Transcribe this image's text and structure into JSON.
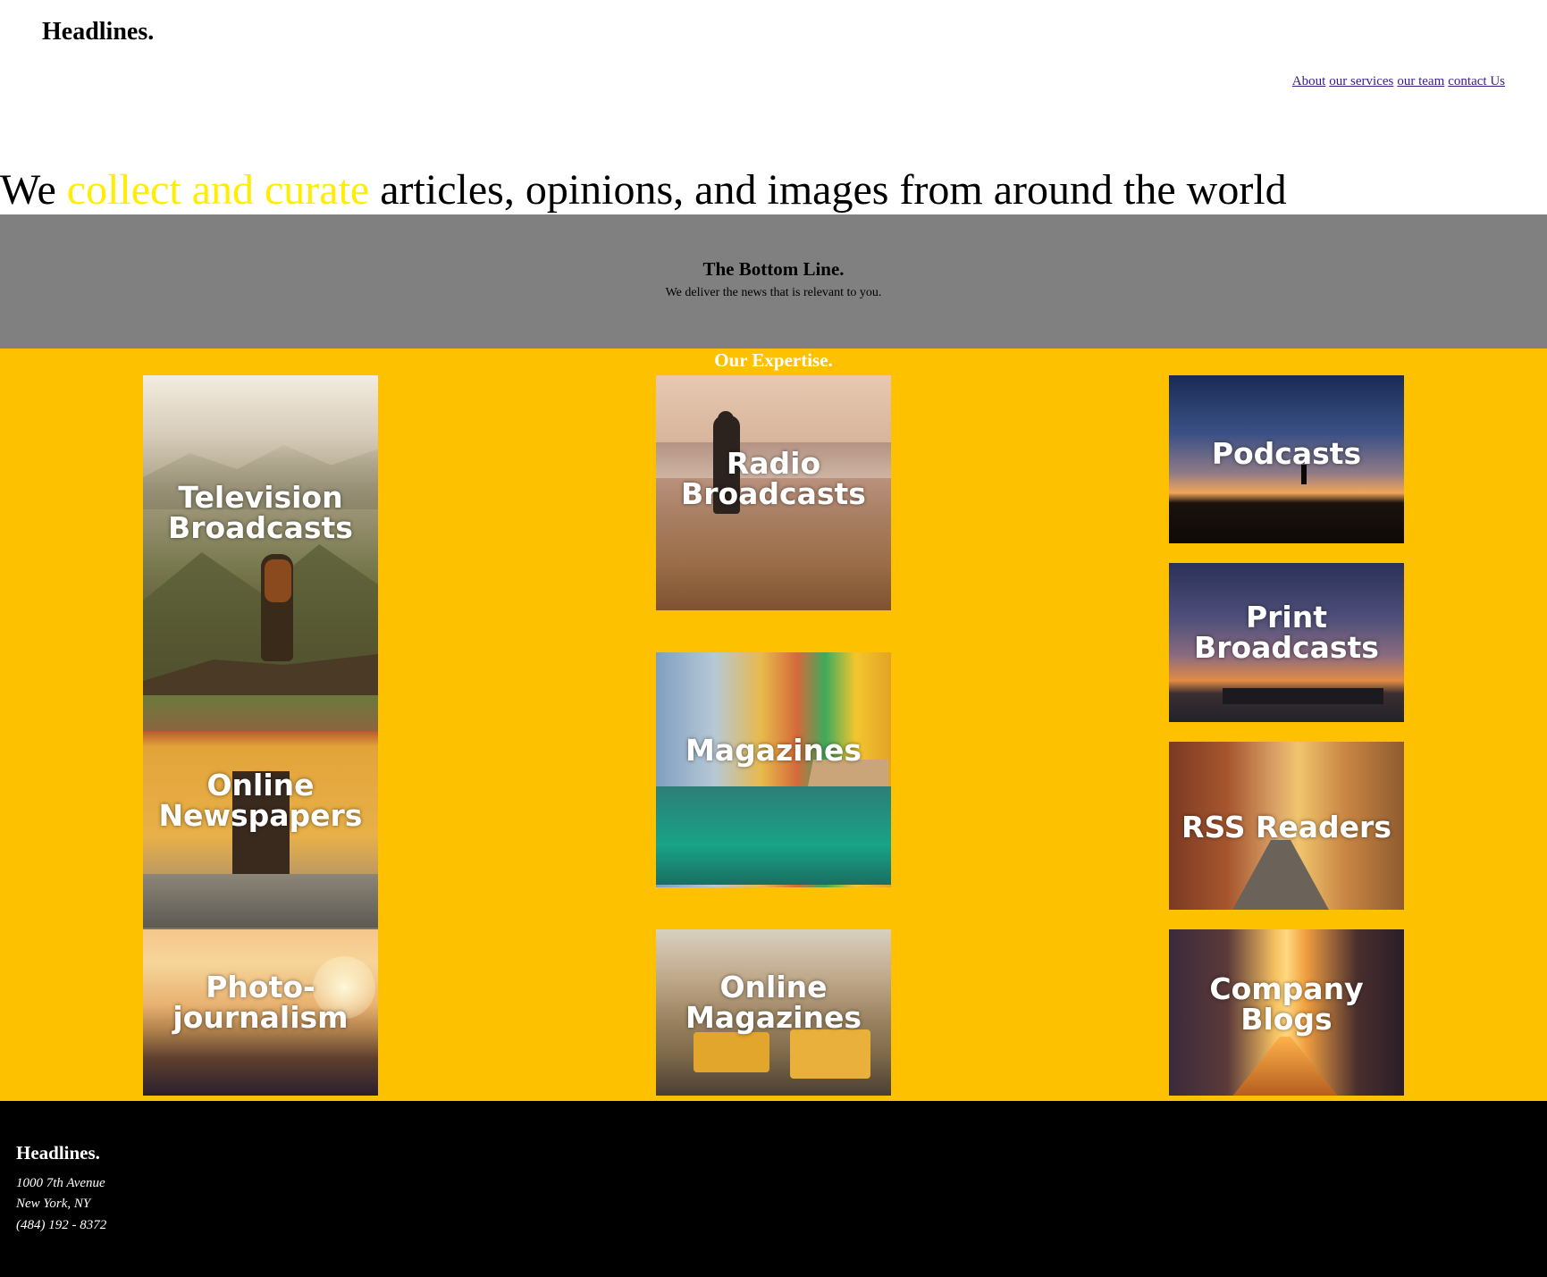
{
  "header": {
    "logo": "Headlines.",
    "nav": [
      {
        "label": "About"
      },
      {
        "label": "our services"
      },
      {
        "label": "our team"
      },
      {
        "label": "contact Us"
      }
    ]
  },
  "hero": {
    "prefix": "We ",
    "highlight": "collect and curate",
    "suffix": " articles, opinions, and images from around the world",
    "highlight_color": "#ffee00"
  },
  "bottom_line": {
    "title": "The Bottom Line.",
    "subtitle": "We deliver the news that is relevant to you.",
    "background": "#808080"
  },
  "expertise": {
    "title": "Our Expertise.",
    "background": "#fdc100",
    "tiles": {
      "television": "Television Broadcasts",
      "online_newspapers": "Online Newspapers",
      "photojournalism": "Photo-journalism",
      "radio": "Radio Broadcasts",
      "magazines": "Magazines",
      "online_magazines": "Online Magazines",
      "podcasts": "Podcasts",
      "print": "Print Broadcasts",
      "rss": "RSS Readers",
      "company_blogs": "Company Blogs"
    }
  },
  "footer": {
    "logo": "Headlines.",
    "address_line1": "1000 7th Avenue",
    "address_line2": "New York, NY",
    "phone": "(484) 192 - 8372"
  }
}
